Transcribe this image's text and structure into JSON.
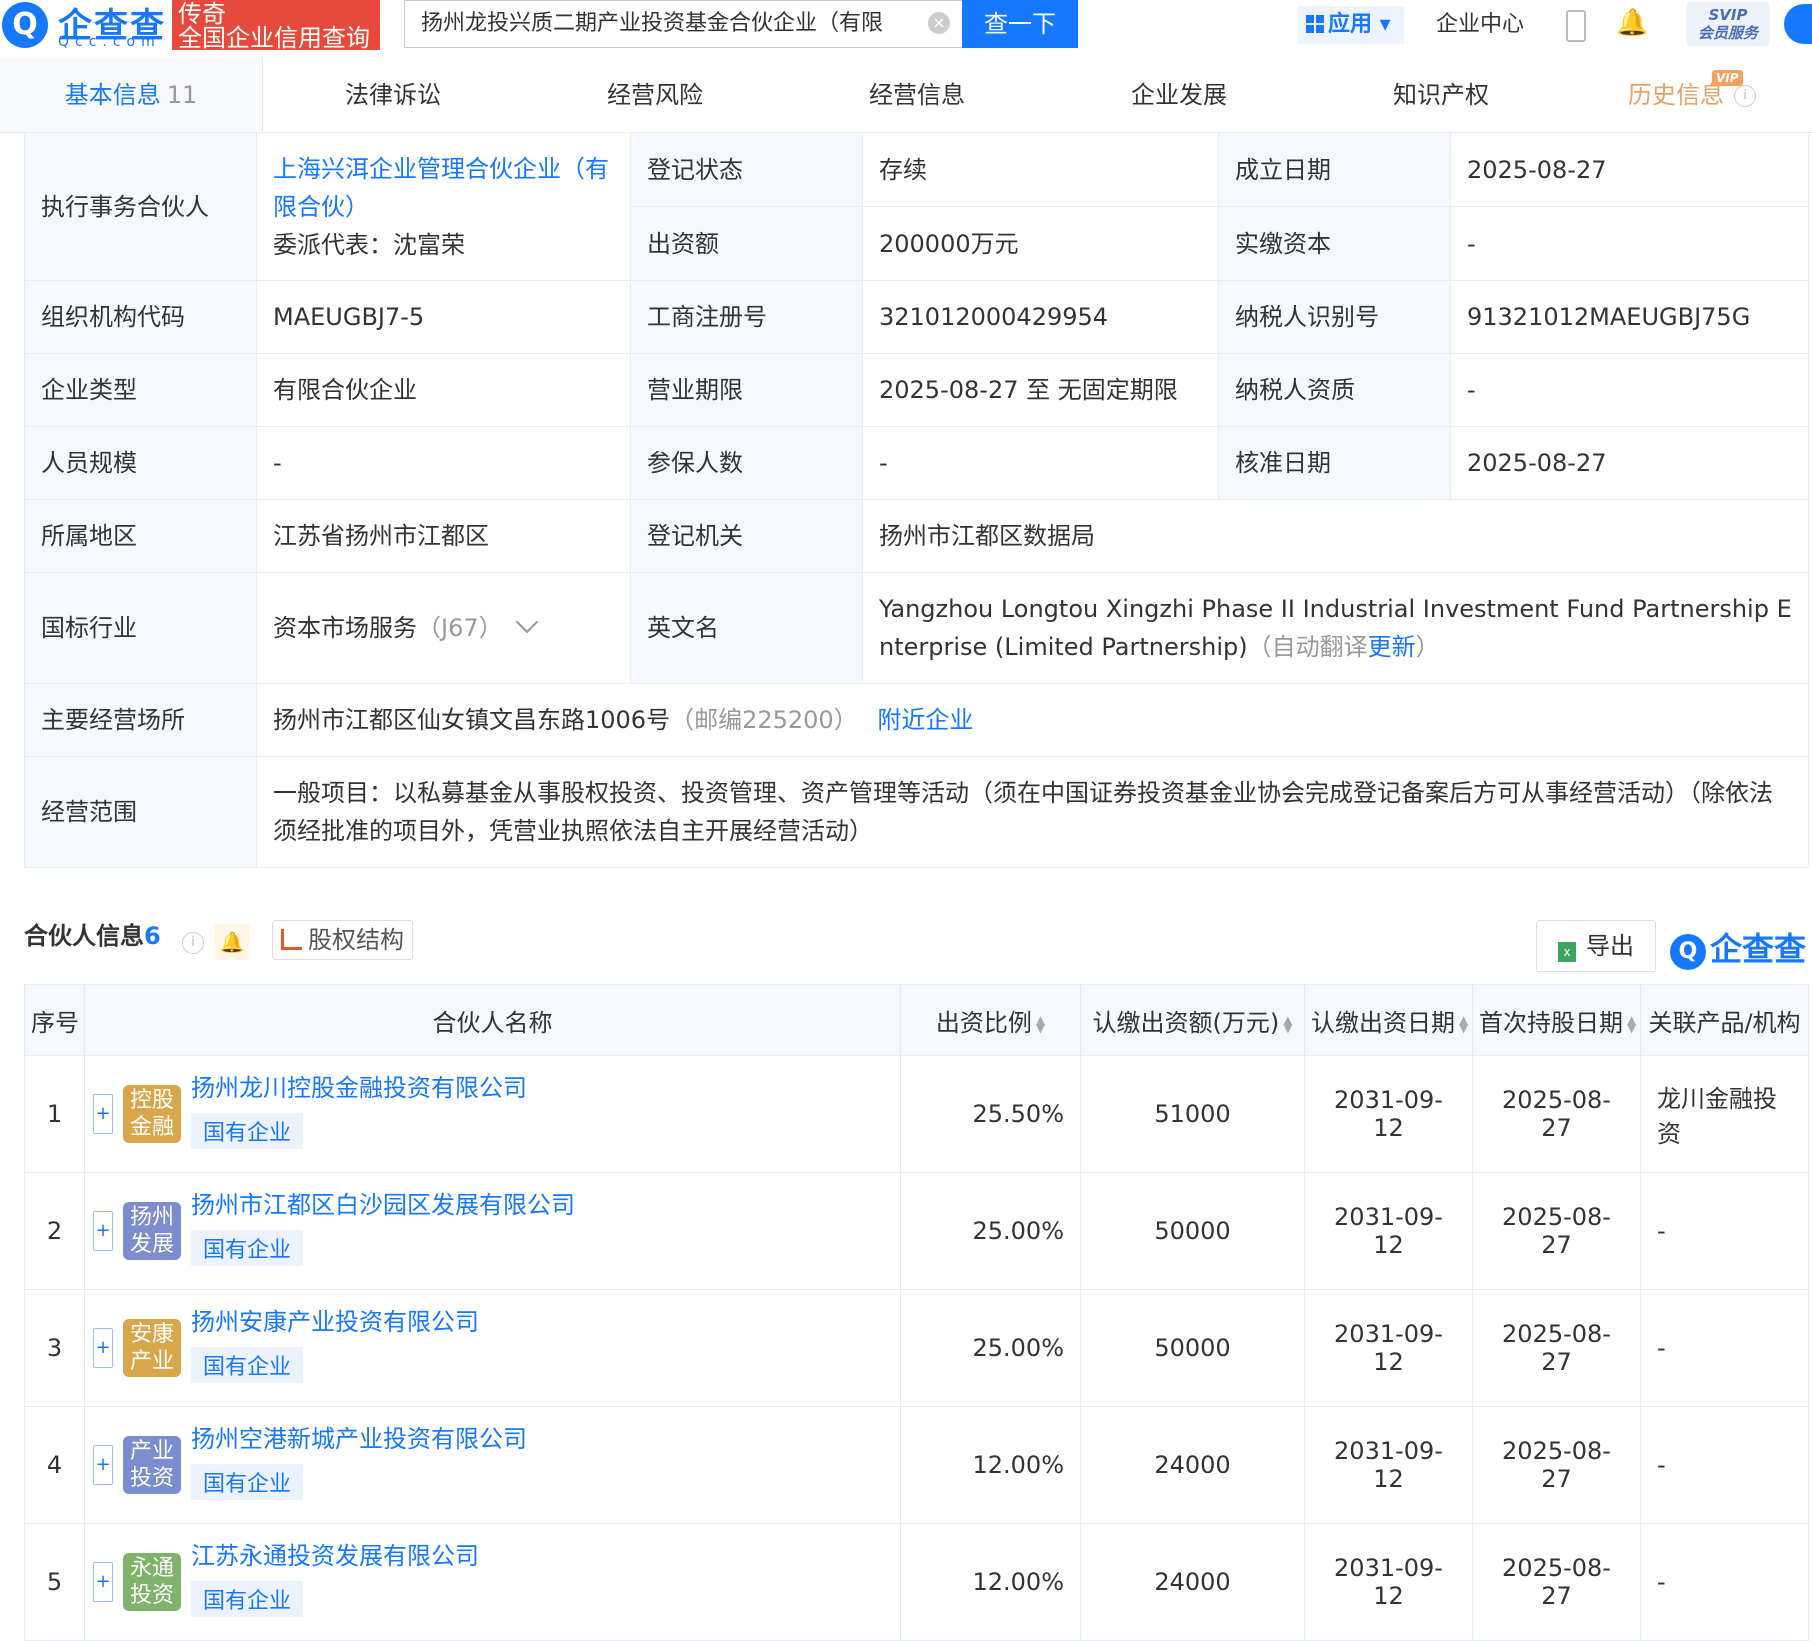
{
  "header": {
    "logo_text": "企查查",
    "logo_sub": "Qcc.com",
    "tag_line1": "传奇",
    "tag_line2": "全国企业信用查询",
    "search_value": "扬州龙投兴质二期产业投资基金合伙企业（有限",
    "search_button": "查一下",
    "apps_label": "应用",
    "enterprise_center": "企业中心",
    "svip_line1": "SVIP",
    "svip_line2": "会员服务"
  },
  "tabs": [
    {
      "label": "基本信息",
      "count": "11"
    },
    {
      "label": "法律诉讼"
    },
    {
      "label": "经营风险"
    },
    {
      "label": "经营信息"
    },
    {
      "label": "企业发展"
    },
    {
      "label": "知识产权"
    },
    {
      "label": "历史信息",
      "badge": "VIP"
    }
  ],
  "basic_info": {
    "partner_label": "执行事务合伙人",
    "partner_name": "上海兴洱企业管理合伙企业（有限合伙）",
    "partner_rep": "委派代表：沈富荣",
    "reg_status_label": "登记状态",
    "reg_status": "存续",
    "founded_label": "成立日期",
    "founded": "2025-08-27",
    "capital_label": "出资额",
    "capital": "200000万元",
    "paid_label": "实缴资本",
    "paid": "-",
    "org_code_label": "组织机构代码",
    "org_code": "MAEUGBJ7-5",
    "biz_reg_label": "工商注册号",
    "biz_reg": "321012000429954",
    "tax_id_label": "纳税人识别号",
    "tax_id": "91321012MAEUGBJ75G",
    "type_label": "企业类型",
    "type": "有限合伙企业",
    "term_label": "营业期限",
    "term": "2025-08-27 至 无固定期限",
    "tax_qual_label": "纳税人资质",
    "tax_qual": "-",
    "staff_label": "人员规模",
    "staff": "-",
    "insured_label": "参保人数",
    "insured": "-",
    "approved_label": "核准日期",
    "approved": "2025-08-27",
    "region_label": "所属地区",
    "region": "江苏省扬州市江都区",
    "authority_label": "登记机关",
    "authority": "扬州市江都区数据局",
    "industry_label": "国标行业",
    "industry": "资本市场服务",
    "industry_code": "（J67）",
    "en_name_label": "英文名",
    "en_name": "Yangzhou Longtou Xingzhi Phase II Industrial Investment Fund Partnership Enterprise (Limited Partnership)",
    "en_name_note_prefix": "（自动翻译",
    "en_name_update": "更新",
    "en_name_note_suffix": "）",
    "address_label": "主要经营场所",
    "address": "扬州市江都区仙女镇文昌东路1006号",
    "postcode": "（邮编225200）",
    "nearby": "附近企业",
    "scope_label": "经营范围",
    "scope": "一般项目：以私募基金从事股权投资、投资管理、资产管理等活动（须在中国证券投资基金业协会完成登记备案后方可从事经营活动）（除依法须经批准的项目外，凭营业执照依法自主开展经营活动）"
  },
  "partners_section": {
    "title": "合伙人信息",
    "count": "6",
    "equity_button": "股权结构",
    "export_button": "导出",
    "brand": "企查查",
    "columns": [
      "序号",
      "合伙人名称",
      "出资比例",
      "认缴出资额(万元)",
      "认缴出资日期",
      "首次持股日期",
      "关联产品/机构"
    ],
    "rows": [
      {
        "no": "1",
        "avatar": "控股金融",
        "avatar_color": "#d9a74a",
        "name": "扬州龙川控股金融投资有限公司",
        "tag": "国有企业",
        "ratio": "25.50%",
        "amount": "51000",
        "sub_date": "2031-09-12",
        "first_date": "2025-08-27",
        "product": "龙川金融投资"
      },
      {
        "no": "2",
        "avatar": "扬州发展",
        "avatar_color": "#7b8ccf",
        "name": "扬州市江都区白沙园区发展有限公司",
        "tag": "国有企业",
        "ratio": "25.00%",
        "amount": "50000",
        "sub_date": "2031-09-12",
        "first_date": "2025-08-27",
        "product": "-"
      },
      {
        "no": "3",
        "avatar": "安康产业",
        "avatar_color": "#d9a74a",
        "name": "扬州安康产业投资有限公司",
        "tag": "国有企业",
        "ratio": "25.00%",
        "amount": "50000",
        "sub_date": "2031-09-12",
        "first_date": "2025-08-27",
        "product": "-"
      },
      {
        "no": "4",
        "avatar": "产业投资",
        "avatar_color": "#7b8ccf",
        "name": "扬州空港新城产业投资有限公司",
        "tag": "国有企业",
        "ratio": "12.00%",
        "amount": "24000",
        "sub_date": "2031-09-12",
        "first_date": "2025-08-27",
        "product": "-"
      },
      {
        "no": "5",
        "avatar": "永通投资",
        "avatar_color": "#7fb26a",
        "name": "江苏永通投资发展有限公司",
        "tag": "国有企业",
        "ratio": "12.00%",
        "amount": "24000",
        "sub_date": "2031-09-12",
        "first_date": "2025-08-27",
        "product": "-"
      }
    ]
  }
}
